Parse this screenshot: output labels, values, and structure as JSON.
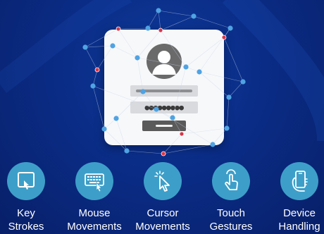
{
  "login_card": {
    "password_mask": "●●●●●●●●●"
  },
  "features": [
    {
      "icon": "keyboard-key-icon",
      "label": "Key\nStrokes"
    },
    {
      "icon": "mouse-keyboard-icon",
      "label": "Mouse\nMovements"
    },
    {
      "icon": "cursor-icon",
      "label": "Cursor\nMovements"
    },
    {
      "icon": "touch-hand-icon",
      "label": "Touch\nGestures"
    },
    {
      "icon": "phone-in-hand-icon",
      "label": "Device\nHandling"
    }
  ],
  "colors": {
    "background": "#0a2c86",
    "accent": "#3d9fc9",
    "node_blue": "#4fa3e3",
    "node_red": "#d6364a"
  }
}
